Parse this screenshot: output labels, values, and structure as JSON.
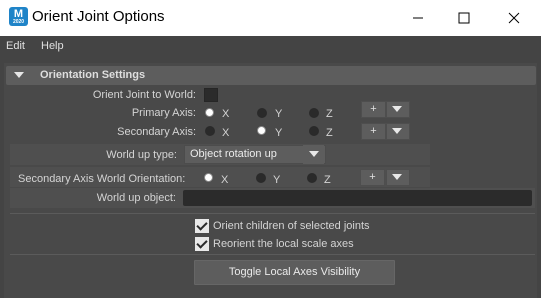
{
  "window": {
    "title": "Orient Joint Options",
    "icon_letter": "M",
    "icon_sub": "2020"
  },
  "menu": {
    "items": [
      "Edit",
      "Help"
    ]
  },
  "section": {
    "title": "Orientation Settings"
  },
  "orient_joint_to_world": {
    "label": "Orient Joint to World:",
    "checked": false
  },
  "primary_axis": {
    "label": "Primary Axis:",
    "options": [
      "X",
      "Y",
      "Z"
    ],
    "selected": "X",
    "plus": "+"
  },
  "secondary_axis": {
    "label": "Secondary Axis:",
    "options": [
      "X",
      "Y",
      "Z"
    ],
    "selected": "Y",
    "plus": "+"
  },
  "world_up_type": {
    "label": "World up type:",
    "value": "Object rotation up"
  },
  "secondary_axis_world_orientation": {
    "label": "Secondary Axis World Orientation:",
    "options": [
      "X",
      "Y",
      "Z"
    ],
    "selected": "X",
    "plus": "+"
  },
  "world_up_object": {
    "label": "World up object:",
    "value": ""
  },
  "orient_children": {
    "label": "Orient children of selected joints",
    "checked": true
  },
  "reorient_scale": {
    "label": "Reorient the local scale axes",
    "checked": true
  },
  "toggle_button": {
    "label": "Toggle Local Axes Visibility"
  },
  "colors": {
    "panel": "#444444",
    "header": "#5d5d5d",
    "field": "#2b2b2b"
  }
}
